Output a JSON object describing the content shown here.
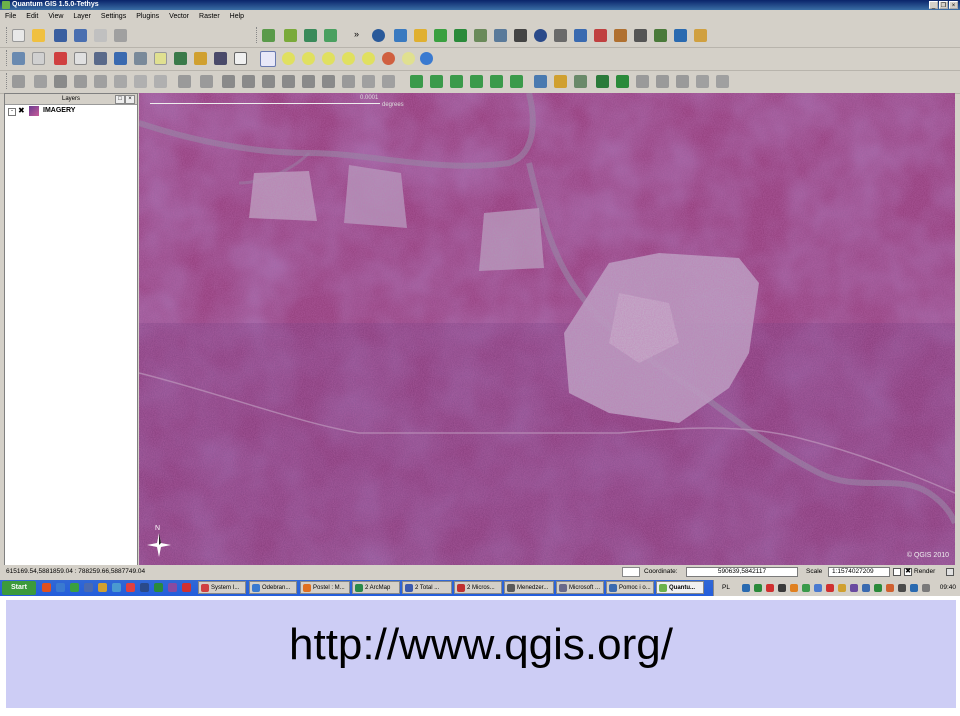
{
  "window": {
    "title": "Quantum GIS 1.5.0-Tethys",
    "controls": [
      "_",
      "❐",
      "×"
    ]
  },
  "menu": [
    "File",
    "Edit",
    "View",
    "Layer",
    "Settings",
    "Plugins",
    "Vector",
    "Raster",
    "Help"
  ],
  "toolbar": {
    "overflow_chevron": "»"
  },
  "layers_panel": {
    "title": "Layers",
    "layers": [
      {
        "name": "IMAGERY",
        "expanded": "-",
        "checked": "✖"
      }
    ]
  },
  "map": {
    "scale_top": "0.0001",
    "scale_unit": "degrees",
    "copyright": "© QGIS 2010",
    "north_arrow": "N"
  },
  "status": {
    "coords_range": "615169.54,5881859.04 : 788259.66,5887749.04",
    "coordinate_label": "Coordinate:",
    "coordinate_value": "590639,5842117",
    "scale_label": "Scale",
    "scale_value": "1:1574027209",
    "render_label": "Render",
    "render_checked": "✖"
  },
  "taskbar": {
    "start_label": "Start",
    "tasks": [
      "System I...",
      "Odebran...",
      "Postel : M...",
      "2 ArcMap",
      "2 Total ...",
      "2 Micros...",
      "Menedzer...",
      "Microsoft ...",
      "Pomoc i o...",
      "Quantu..."
    ],
    "tray_lang": "PL",
    "clock": "09:40"
  },
  "slide": {
    "url": "http://www.qgis.org/"
  },
  "colors": {
    "titlebar": "#0a246a",
    "taskbar": "#245edb",
    "slide_bg": "#cdcdf5",
    "imagery_forest": "#8a3a7a",
    "imagery_clearing": "#b9a8c0"
  }
}
